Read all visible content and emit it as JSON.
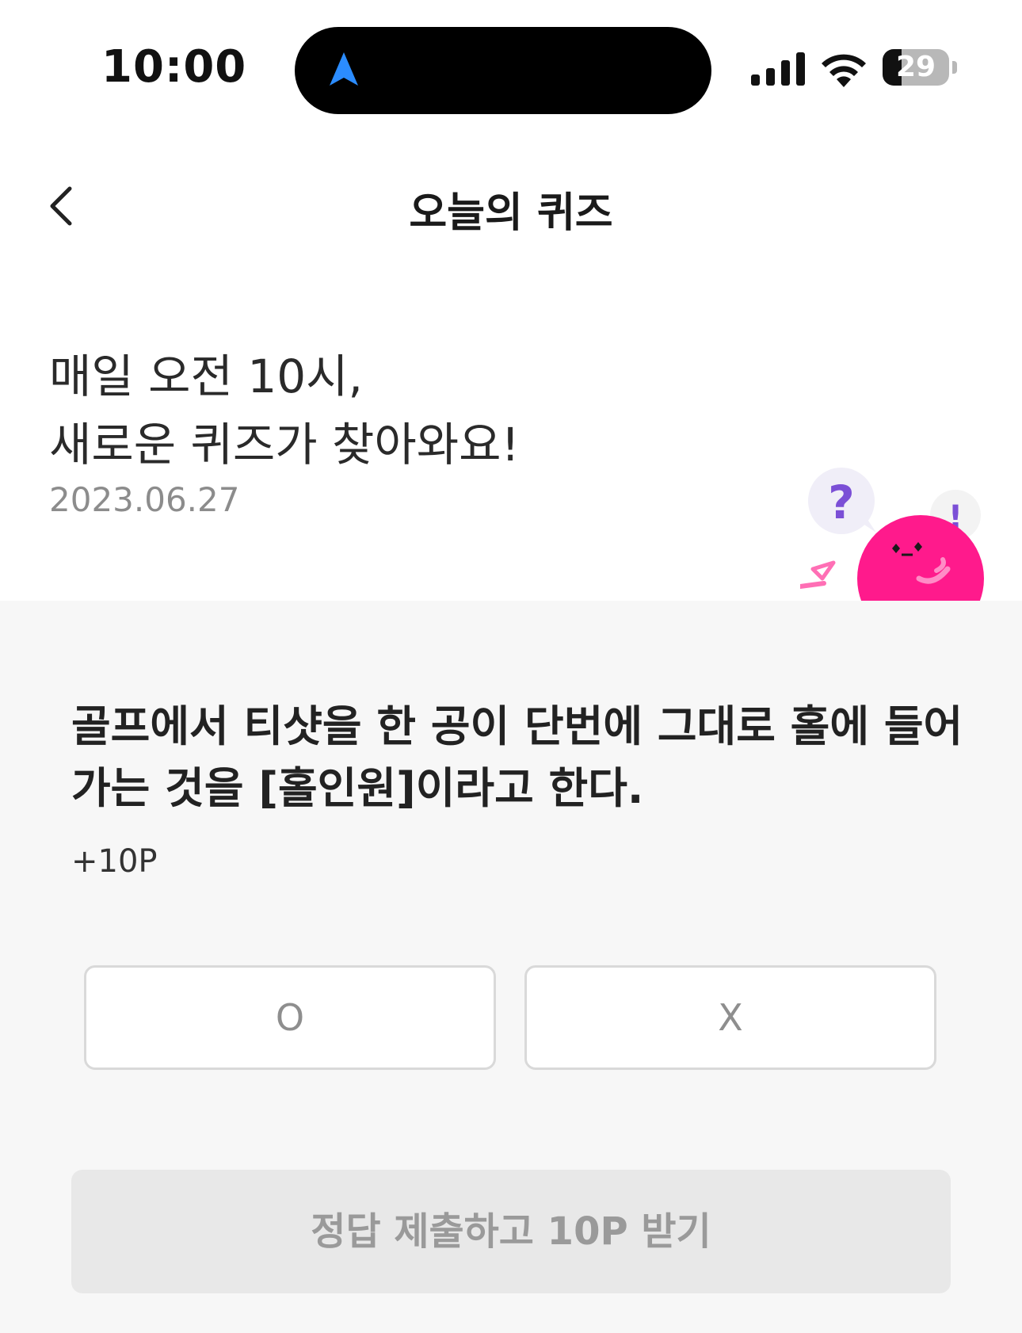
{
  "status_bar": {
    "time": "10:00",
    "battery_level": "29"
  },
  "header": {
    "title": "오늘의 퀴즈"
  },
  "intro": {
    "line1": "매일 오전 10시,",
    "line2": "새로운 퀴즈가 찾아와요!",
    "date": "2023.06.27"
  },
  "mascot": {
    "question_mark": "?",
    "exclamation_mark": "!"
  },
  "quiz": {
    "question_line1": "골프에서 티샷을 한 공이 단번에 그대로 홀에 들어",
    "question_line2": "가는 것을 [홀인원]이라고 한다.",
    "reward": "+10P",
    "option_o": "O",
    "option_x": "X",
    "submit_label": "정답 제출하고 10P 받기"
  },
  "colors": {
    "mascot_pink": "#ff1a8c",
    "navigation_blue": "#2b8cff",
    "question_purple": "#7b4fd6"
  }
}
